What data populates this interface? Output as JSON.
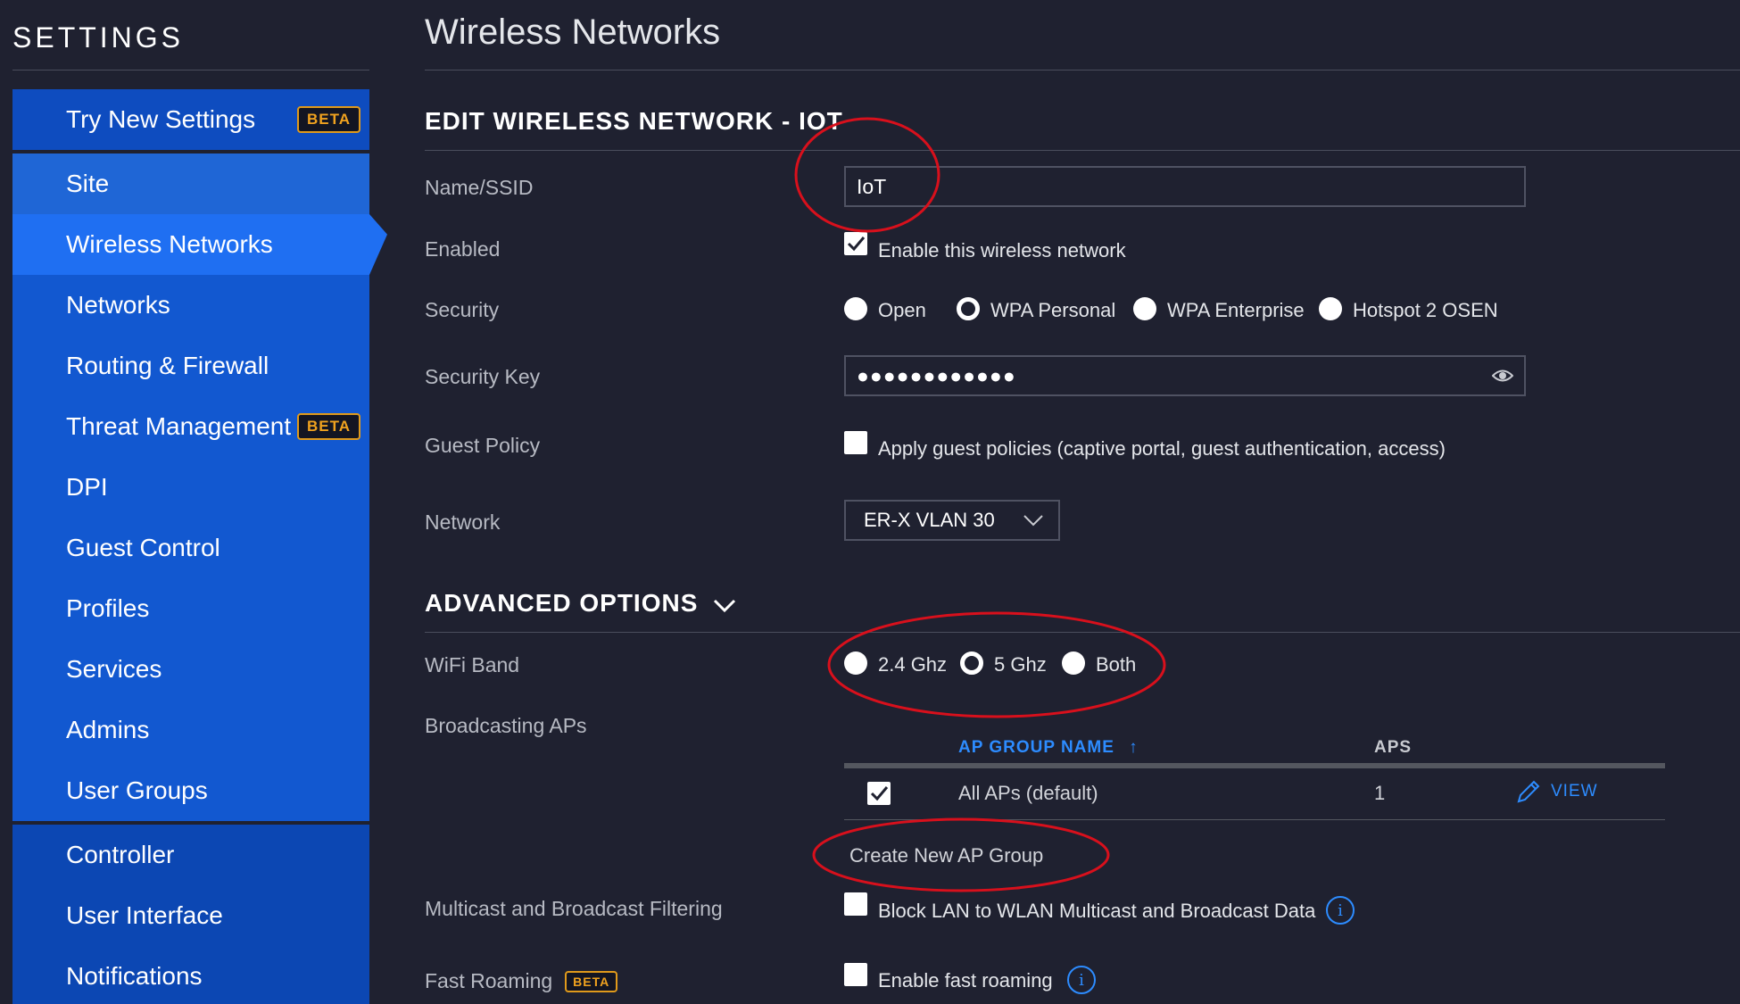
{
  "sidebar": {
    "title": "SETTINGS",
    "beta": "BETA",
    "items": [
      {
        "label": "Try New Settings",
        "badge": "BETA"
      },
      {
        "label": "Site"
      },
      {
        "label": "Wireless Networks"
      },
      {
        "label": "Networks"
      },
      {
        "label": "Routing & Firewall"
      },
      {
        "label": "Threat Management",
        "badge": "BETA"
      },
      {
        "label": "DPI"
      },
      {
        "label": "Guest Control"
      },
      {
        "label": "Profiles"
      },
      {
        "label": "Services"
      },
      {
        "label": "Admins"
      },
      {
        "label": "User Groups"
      },
      {
        "label": "Controller"
      },
      {
        "label": "User Interface"
      },
      {
        "label": "Notifications"
      }
    ]
  },
  "main": {
    "title": "Wireless Networks",
    "edit_title": "EDIT WIRELESS NETWORK - IOT",
    "name_label": "Name/SSID",
    "name_value": "IoT",
    "enabled_label": "Enabled",
    "enabled_text": "Enable this wireless network",
    "security_label": "Security",
    "security_options": [
      "Open",
      "WPA Personal",
      "WPA Enterprise",
      "Hotspot 2 OSEN"
    ],
    "security_selected": "WPA Personal",
    "key_label": "Security Key",
    "key_value": "●●●●●●●●●●●●",
    "guest_label": "Guest Policy",
    "guest_text": "Apply guest policies (captive portal, guest authentication, access)",
    "network_label": "Network",
    "network_value": "ER-X VLAN 30",
    "advanced_title": "ADVANCED OPTIONS",
    "band_label": "WiFi Band",
    "band_options": [
      "2.4 Ghz",
      "5 Ghz",
      "Both"
    ],
    "band_selected": "5 Ghz",
    "broadcast_label": "Broadcasting APs",
    "table": {
      "col_group": "AP GROUP NAME",
      "sort_arrow": "↑",
      "col_aps": "APS",
      "rows": [
        {
          "name": "All APs (default)",
          "aps": "1",
          "action": "VIEW"
        }
      ]
    },
    "create_group": "Create New AP Group",
    "multicast_label": "Multicast and Broadcast Filtering",
    "multicast_text": "Block LAN to WLAN Multicast and Broadcast Data",
    "fast_label": "Fast Roaming",
    "fast_badge": "BETA",
    "fast_text": "Enable fast roaming",
    "info_glyph": "i"
  },
  "colors": {
    "background": "#1f2130",
    "nav_dark": "#0d3f9a",
    "nav_active": "#1f6ff2",
    "accent": "#2d8cff",
    "badge": "#f0a21f",
    "annotation": "#d8101c"
  }
}
